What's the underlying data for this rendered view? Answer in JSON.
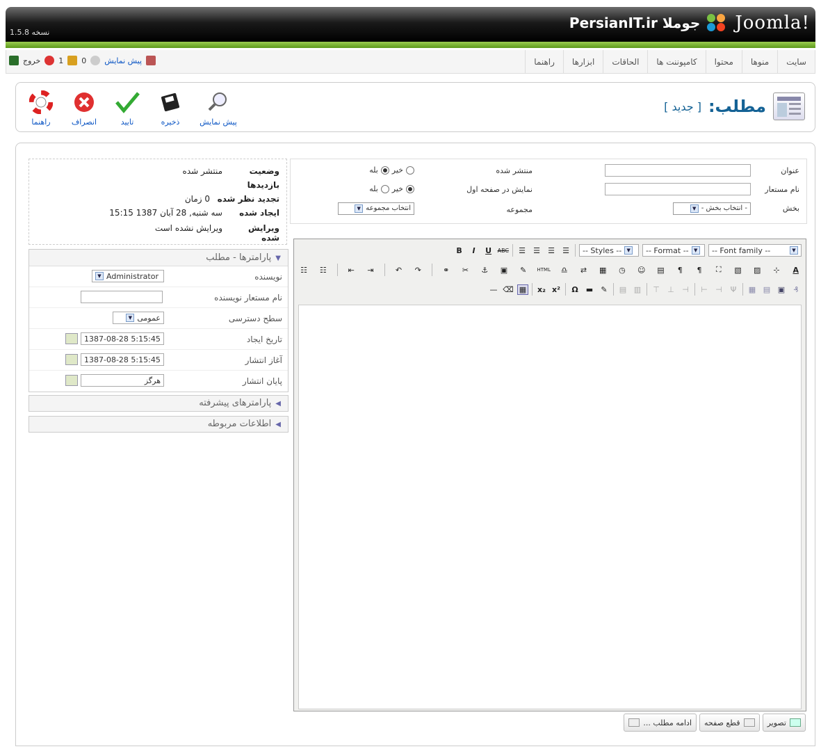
{
  "header": {
    "version": "نسخه 1.5.8",
    "site_name": "PersianIT.ir جوملا",
    "logo_text": "Joomla!"
  },
  "top_menu": [
    "سایت",
    "منوها",
    "محتوا",
    "کامپوننت ها",
    "الحاقات",
    "ابزارها",
    "راهنما"
  ],
  "status": {
    "preview": "پیش نمایش",
    "messages": "0",
    "users": "1",
    "logout": "خروج"
  },
  "toolbar": {
    "help": "راهنما",
    "cancel": "انصراف",
    "apply": "تایید",
    "save": "ذخیره",
    "preview": "پیش نمایش"
  },
  "page": {
    "title": "مطلب:",
    "subtitle": "[ جدید ]"
  },
  "details": {
    "title_label": "عنوان",
    "alias_label": "نام مستعار",
    "section_label": "بخش",
    "published_label": "منتشر شده",
    "frontpage_label": "نمایش در صفحه اول",
    "category_label": "مجموعه",
    "yes": "بله",
    "no": "خیر",
    "section_select": "- انتخاب بخش -",
    "category_select": "انتخاب مجموعه"
  },
  "info": {
    "state_label": "وضعیت",
    "state_value": "منتشر شده",
    "hits_label": "بازدیدها",
    "revised_label": "تجدید نظر شده",
    "revised_value": "0 زمان",
    "created_label": "ایجاد شده",
    "created_value": "سه شنبه, 28 آبان 1387 15:15",
    "modified_label": "ویرایش شده",
    "modified_value": "ویرایش نشده است"
  },
  "params": {
    "title": "پارامترها - مطلب",
    "author_label": "نویسنده",
    "author_value": "Administrator",
    "author_alias_label": "نام مستعار نویسنده",
    "access_label": "سطح دسترسی",
    "access_value": "عمومی",
    "created_date_label": "تاریخ ایجاد",
    "created_date_value": "1387-08-28 5:15:45",
    "publish_up_label": "آغاز انتشار",
    "publish_up_value": "1387-08-28 5:15:45",
    "publish_down_label": "پایان انتشار",
    "publish_down_value": "هرگز",
    "advanced": "پارامترهای پیشرفته",
    "metadata": "اطلاعات مربوطه"
  },
  "editor": {
    "styles": "-- Styles --",
    "format": "-- Format --",
    "font_family": "-- Font family --"
  },
  "editor_buttons": {
    "image": "تصویر",
    "pagebreak": "قطع صفحه",
    "readmore": "ادامه مطلب ..."
  },
  "colors": {
    "accent_green": "#5c9a1a",
    "link_blue": "#0B55C4",
    "title_blue": "#146295"
  }
}
